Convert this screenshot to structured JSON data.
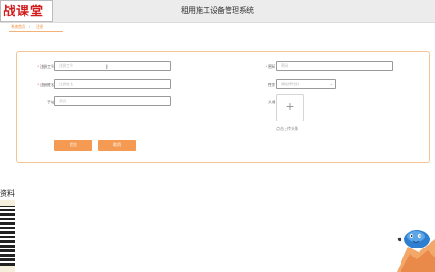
{
  "header": {
    "logo_text": "战课堂",
    "title": "租用施工设备管理系统"
  },
  "breadcrumb": {
    "home": "系统首页",
    "separator": "/",
    "current": "注册"
  },
  "form": {
    "fields": [
      {
        "label": "注册工号",
        "required": true,
        "placeholder": "注册工号"
      },
      {
        "label": "密码",
        "required": true,
        "placeholder": "密码"
      },
      {
        "label": "注册姓名",
        "required": true,
        "placeholder": "注册姓名"
      },
      {
        "label": "性别",
        "required": false,
        "placeholder": "请选择性别"
      },
      {
        "label": "手机",
        "required": false,
        "placeholder": "手机"
      },
      {
        "label": "头像",
        "required": false,
        "placeholder": ""
      }
    ],
    "upload_hint": "点击上传头像",
    "submit_label": "提交",
    "cancel_label": "取消"
  },
  "side": {
    "label": "资料"
  },
  "colors": {
    "accent": "#f59a52",
    "required": "#e53935",
    "logo": "#d21c1c",
    "card_border": "#f4c493"
  },
  "icons": {
    "upload": "plus-icon",
    "select": "chevron-down-icon",
    "cursor": "text-cursor-icon"
  }
}
